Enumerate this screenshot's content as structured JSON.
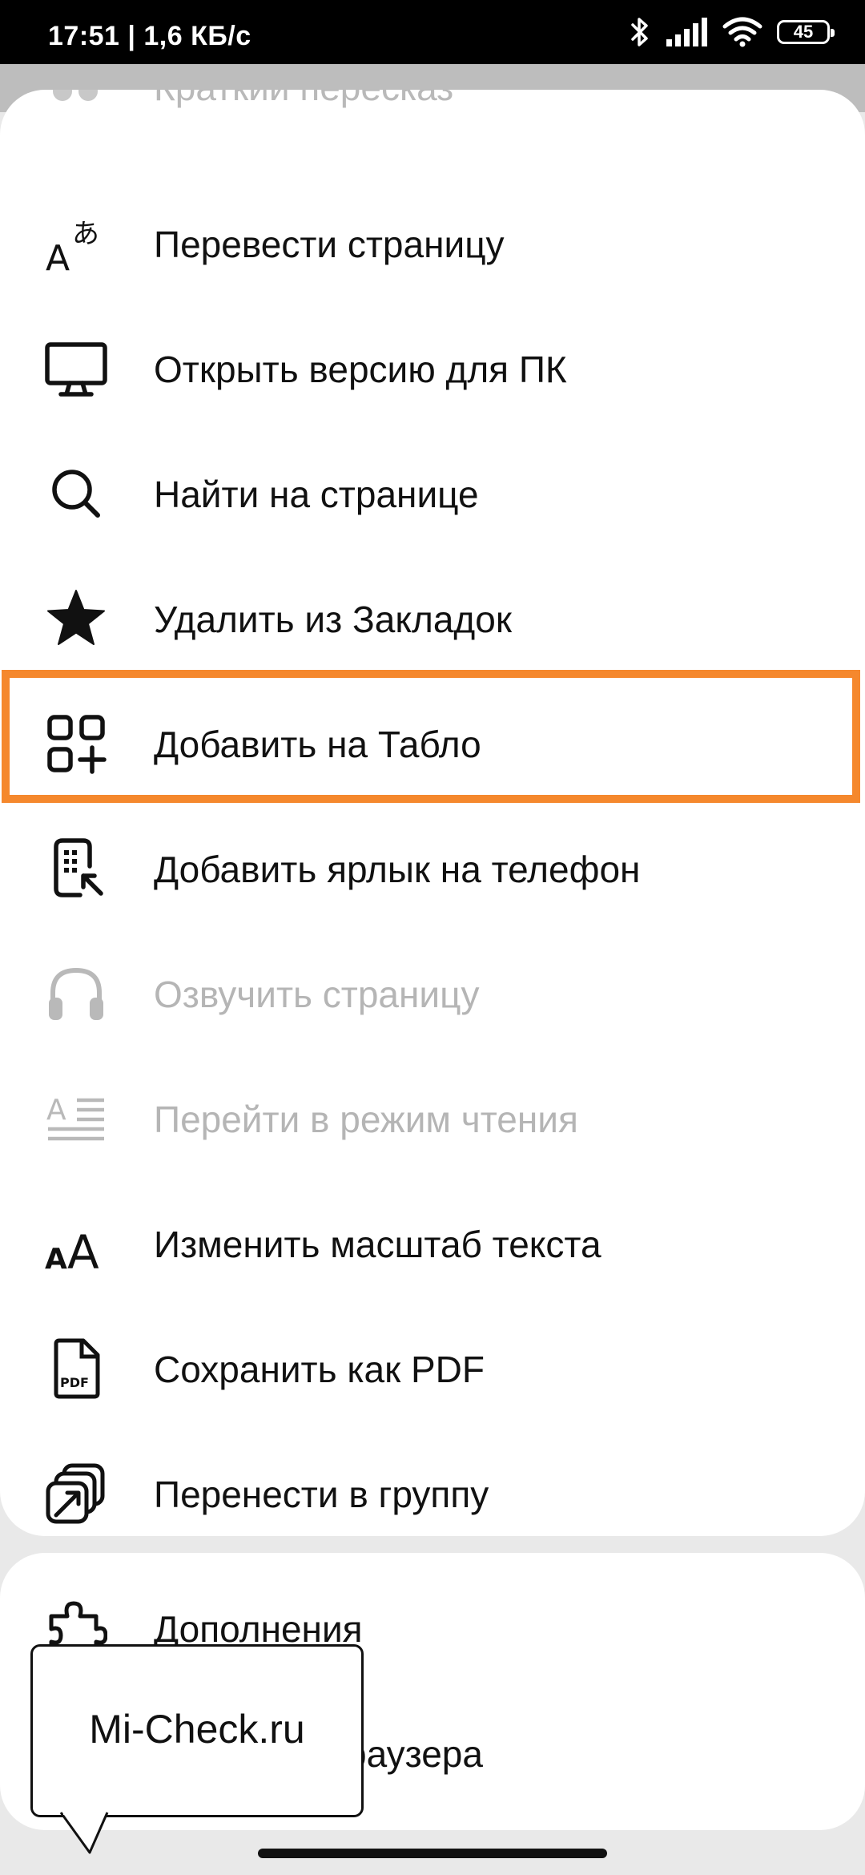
{
  "status_bar": {
    "time": "17:51 | 1,6 КБ/с",
    "battery": "45",
    "icons": [
      "bluetooth-icon",
      "signal-icon",
      "wifi-icon",
      "battery-icon"
    ]
  },
  "menu": {
    "partial_item": {
      "label": "Краткий пересказ",
      "icon": "summary-icon"
    },
    "items": [
      {
        "label": "Перевести страницу",
        "icon": "translate-icon",
        "enabled": true
      },
      {
        "label": "Открыть версию для ПК",
        "icon": "desktop-icon",
        "enabled": true
      },
      {
        "label": "Найти на странице",
        "icon": "search-icon",
        "enabled": true
      },
      {
        "label": "Удалить из Закладок",
        "icon": "star-icon",
        "enabled": true
      },
      {
        "label": "Добавить на Табло",
        "icon": "add-tile-icon",
        "enabled": true
      },
      {
        "label": "Добавить ярлык на телефон",
        "icon": "phone-shortcut-icon",
        "enabled": true,
        "highlighted": true
      },
      {
        "label": "Озвучить страницу",
        "icon": "headphones-icon",
        "enabled": false
      },
      {
        "label": "Перейти в режим чтения",
        "icon": "reader-mode-icon",
        "enabled": false
      },
      {
        "label": "Изменить масштаб текста",
        "icon": "text-size-icon",
        "enabled": true
      },
      {
        "label": "Сохранить как PDF",
        "icon": "pdf-icon",
        "enabled": true
      },
      {
        "label": "Перенести в группу",
        "icon": "move-to-group-icon",
        "enabled": true
      }
    ]
  },
  "secondary_menu": {
    "items": [
      {
        "label": "Дополнения",
        "icon": "puzzle-icon"
      },
      {
        "label": "раузера",
        "icon": "settings-icon"
      }
    ]
  },
  "watermark": {
    "text": "Mi-Check.ru"
  },
  "colors": {
    "highlight": "#f5882d",
    "text": "#111111",
    "disabled_text": "#b5b5b5"
  }
}
